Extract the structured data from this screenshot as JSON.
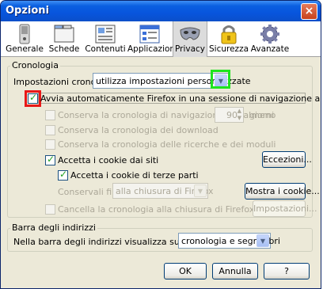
{
  "window": {
    "title": "Opzioni",
    "close_label": "×"
  },
  "toolbar": {
    "items": [
      {
        "label": "Generale",
        "icon": "switch-icon"
      },
      {
        "label": "Schede",
        "icon": "tabs-icon"
      },
      {
        "label": "Contenuti",
        "icon": "contents-icon"
      },
      {
        "label": "Applicazioni",
        "icon": "applications-icon"
      },
      {
        "label": "Privacy",
        "icon": "mask-icon",
        "selected": true
      },
      {
        "label": "Sicurezza",
        "icon": "padlock-icon"
      },
      {
        "label": "Avanzate",
        "icon": "gear-icon"
      }
    ]
  },
  "history": {
    "group_title": "Cronologia",
    "settings_label": "Impostazioni cronologia:",
    "settings_value": "utilizza impostazioni personalizzate",
    "private_mode_label": "Avvia automaticamente Firefox in una sessione di navigazione anonima",
    "private_mode_checked": true,
    "keep_history_label": "Conserva la cronologia di navigazione per almeno",
    "keep_history_days": "90",
    "days_label": "giorni",
    "download_history_label": "Conserva la cronologia dei download",
    "form_history_label": "Conserva la cronologia delle ricerche e dei moduli",
    "accept_cookies_label": "Accetta i cookie dai siti",
    "accept_cookies_checked": true,
    "exceptions_button": "Eccezioni...",
    "third_party_label": "Accetta i cookie di terze parti",
    "third_party_checked": true,
    "keep_until_label": "Conservali fino:",
    "keep_until_value": "alla chiusura di Firefox",
    "show_cookies_button": "Mostra i cookie...",
    "clear_on_close_label": "Cancella la cronologia alla chiusura di Firefox",
    "settings_button": "Impostazioni..."
  },
  "location_bar": {
    "group_title": "Barra degli indirizzi",
    "suggest_label": "Nella barra degli indirizzi visualizza suggerimenti da:",
    "suggest_value": "cronologia e segnalibri"
  },
  "footer": {
    "ok": "OK",
    "cancel": "Annulla",
    "help": "?"
  },
  "colors": {
    "highlight_green": "#1ee41e",
    "highlight_red": "#e81818",
    "titlebar": "#0855dd"
  }
}
